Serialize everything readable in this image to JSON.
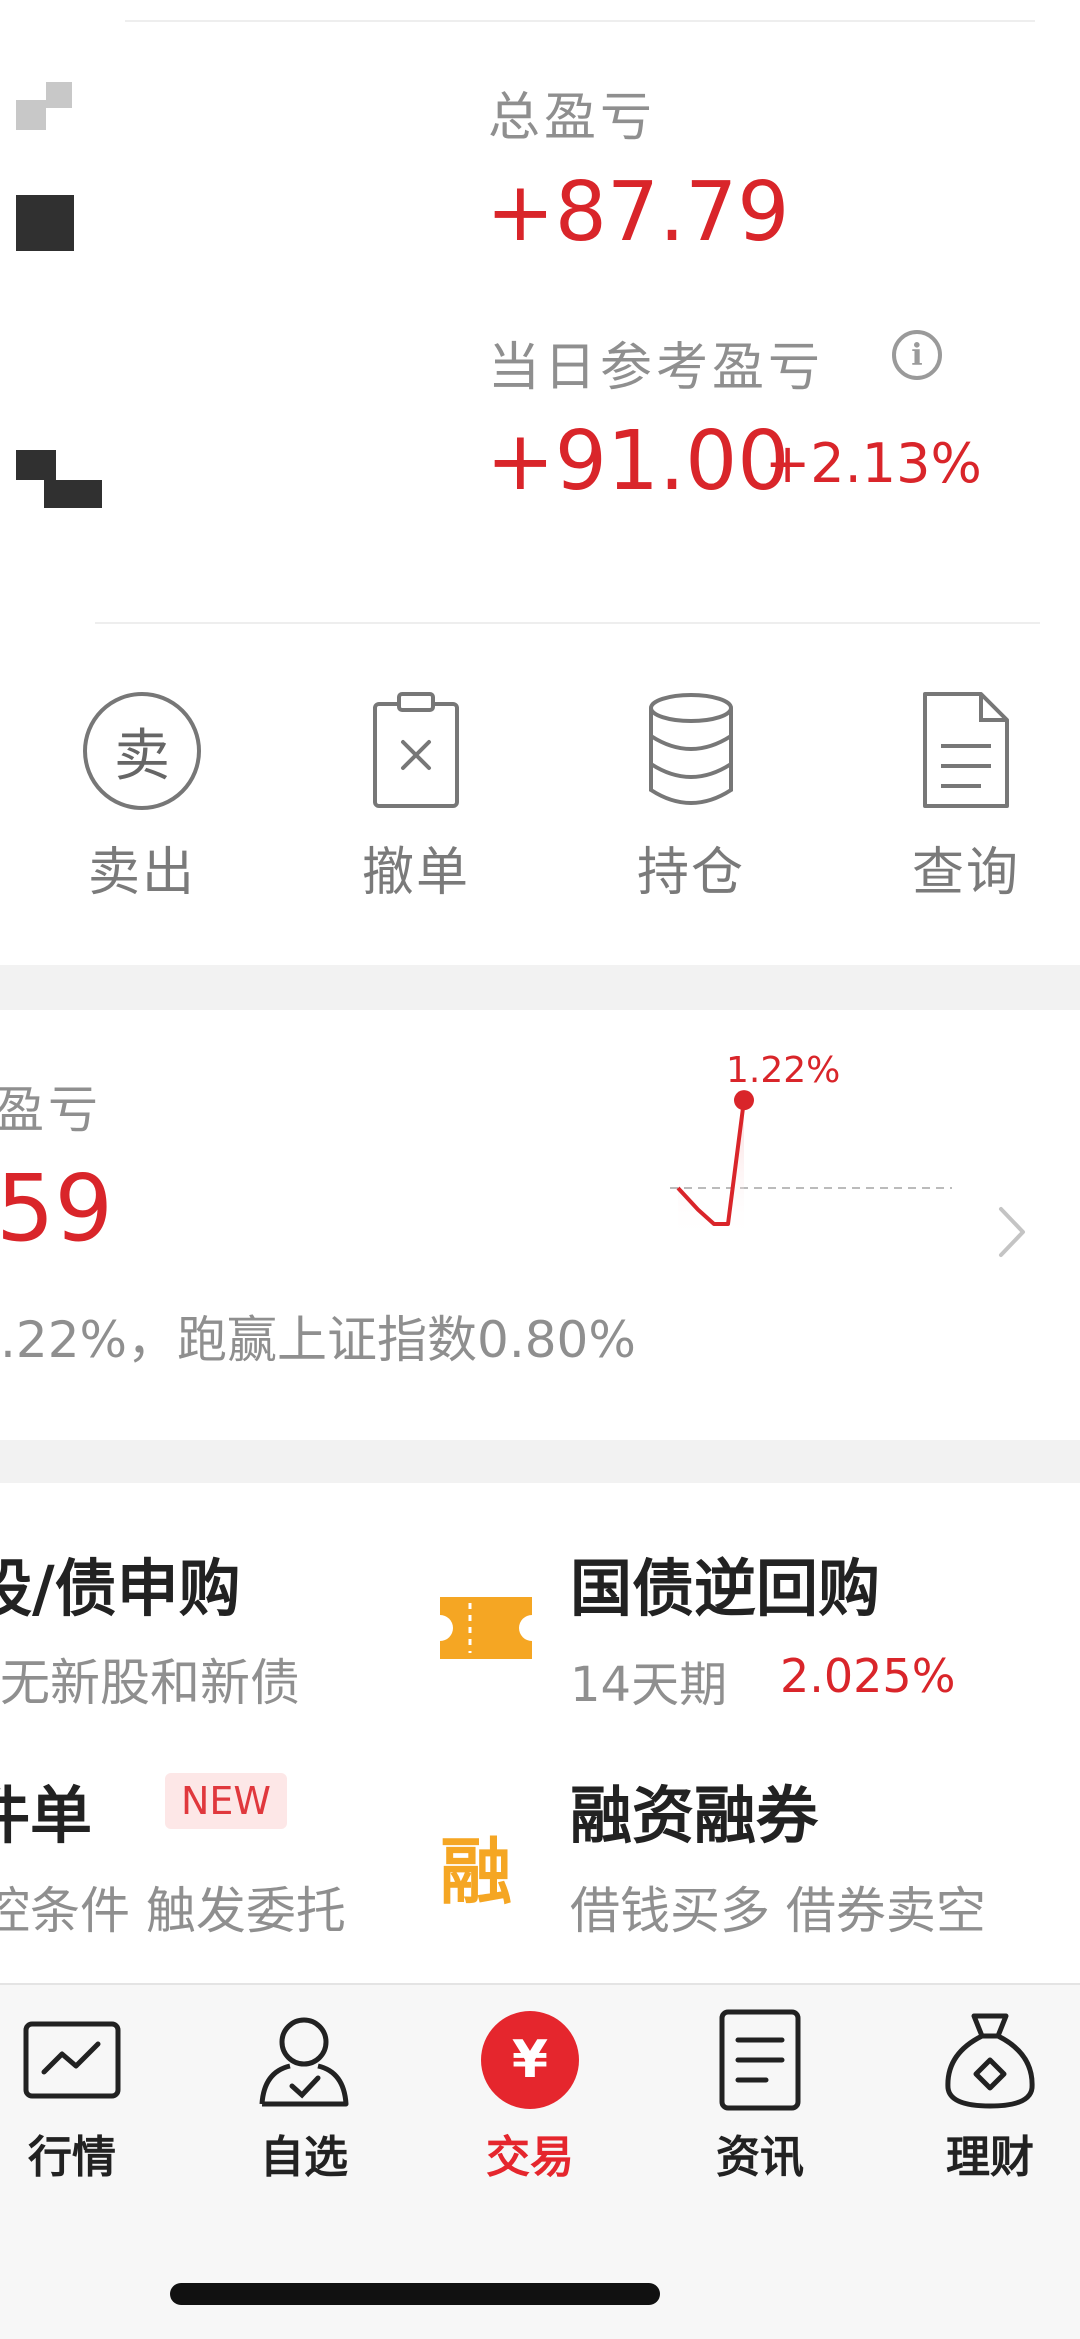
{
  "summary": {
    "total_pl_label": "总盈亏",
    "total_pl_value": "+87.79",
    "daily_pl_label": "当日参考盈亏",
    "daily_pl_value": "+91.00",
    "daily_pl_percent": "+2.13%"
  },
  "actions": [
    {
      "label": "卖出",
      "icon": "sell-icon",
      "glyph": "卖"
    },
    {
      "label": "撤单",
      "icon": "cancel-order-icon"
    },
    {
      "label": "持仓",
      "icon": "database-icon"
    },
    {
      "label": "查询",
      "icon": "document-icon"
    }
  ],
  "profit_card": {
    "title_partial": "盈亏",
    "value_partial": "59",
    "desc_partial": ".22%，跑赢上证指数0.80%",
    "chart_peak_label": "1.22%"
  },
  "chart_data": {
    "type": "line",
    "series": [
      {
        "values": [
          0.0,
          -0.3,
          -0.5,
          -0.5,
          1.22
        ]
      }
    ],
    "annotations": [
      "1.22%"
    ]
  },
  "services": [
    {
      "title": "股/债申购",
      "subtitle": "无新股和新债"
    },
    {
      "title": "国债逆回购",
      "subtitle": "14天期",
      "rate": "2.025%",
      "icon": "ticket-icon"
    },
    {
      "title": "件单",
      "badge": "NEW",
      "subtitle": "控条件 触发委托"
    },
    {
      "title": "融资融券",
      "subtitle": "借钱买多 借券卖空",
      "icon_glyph": "融"
    }
  ],
  "tabs": [
    {
      "label": "行情",
      "icon": "market-chart-icon",
      "active": false
    },
    {
      "label": "自选",
      "icon": "watchlist-user-icon",
      "active": false
    },
    {
      "label": "交易",
      "icon": "trade-yen-icon",
      "active": true,
      "glyph": "¥"
    },
    {
      "label": "资讯",
      "icon": "news-icon",
      "active": false
    },
    {
      "label": "理财",
      "icon": "wealth-bag-icon",
      "active": false
    }
  ],
  "colors": {
    "red": "#d9252a",
    "orange": "#f5a623",
    "gray": "#8f8f8f"
  }
}
